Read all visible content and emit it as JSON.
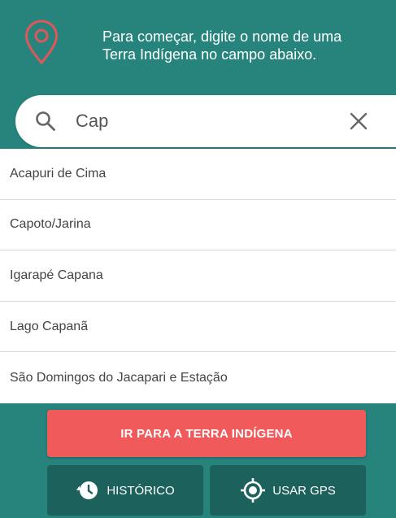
{
  "header": {
    "intro_line1": "Para começar, digite o nome de uma",
    "intro_line2": "Terra Indígena no campo abaixo.",
    "pin_icon": "map-pin-icon",
    "pin_color": "#e0575b",
    "background": "#26847d"
  },
  "search": {
    "value": "Cap",
    "search_icon": "search-icon",
    "clear_icon": "close-icon"
  },
  "results": [
    {
      "label": "Acapuri de Cima"
    },
    {
      "label": "Capoto/Jarina"
    },
    {
      "label": "Igarapé Capana"
    },
    {
      "label": "Lago Capanã"
    },
    {
      "label": "São Domingos do Jacapari e Estação"
    }
  ],
  "actions": {
    "go_label": "IR PARA A TERRA INDÍGENA",
    "go_color": "#f15a5a",
    "history_label": "HISTÓRICO",
    "history_icon": "history-icon",
    "gps_label": "USAR GPS",
    "gps_icon": "gps-target-icon"
  }
}
